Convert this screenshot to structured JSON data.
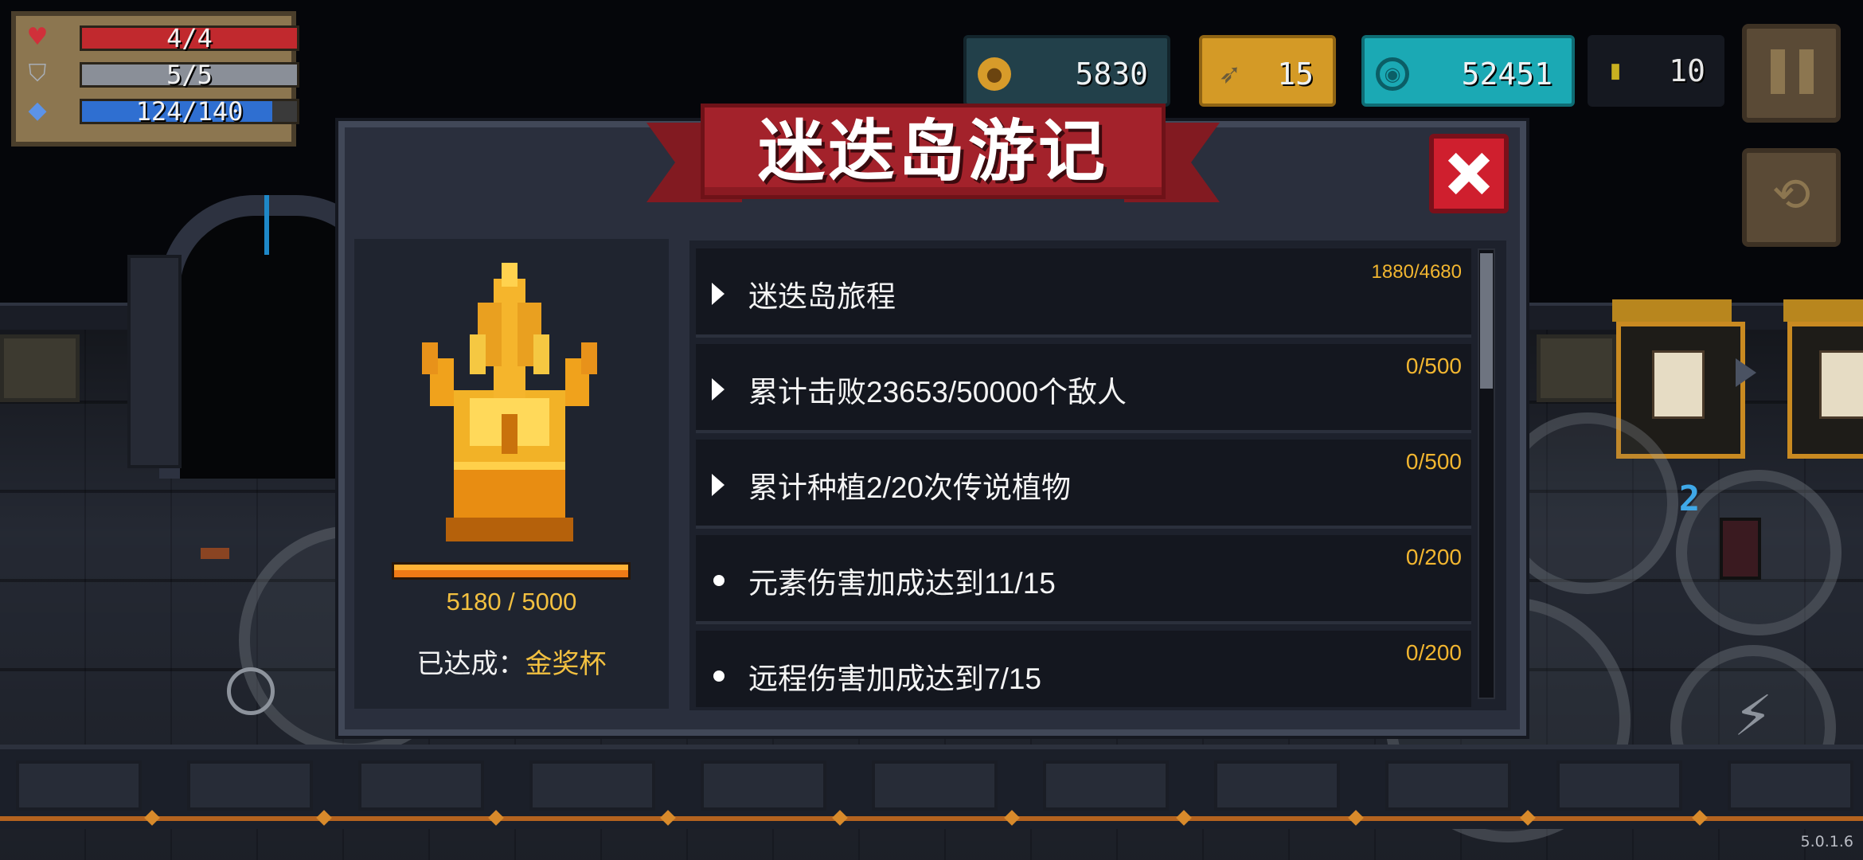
{
  "hud": {
    "health": {
      "label": "4/4",
      "current": 4,
      "max": 4,
      "color": "#c1292e",
      "icon": "heart-icon"
    },
    "armor": {
      "label": "5/5",
      "current": 5,
      "max": 5,
      "color": "#8a8f98",
      "icon": "shield-icon"
    },
    "energy": {
      "label": "124/140",
      "current": 124,
      "max": 140,
      "color": "#2f6fd1",
      "icon": "diamond-icon"
    }
  },
  "currencies": {
    "gold": {
      "value": "5830",
      "icon": "gold-coin-icon"
    },
    "fish": {
      "value": "15",
      "icon": "fish-icon"
    },
    "gems": {
      "value": "52451",
      "icon": "gem-icon"
    },
    "coins": {
      "value": "10",
      "icon": "small-coin-icon"
    }
  },
  "dialog": {
    "title": "迷迭岛游记",
    "trophy": {
      "progress_text": "5180 / 5000",
      "progress_fraction": 1.0,
      "achieved_label": "已达成：",
      "achieved_value": "金奖杯"
    },
    "tasks": [
      {
        "label": "迷迭岛旅程",
        "progress": "1880/4680",
        "marker": "triangle"
      },
      {
        "label": "累计击败23653/50000个敌人",
        "progress": "0/500",
        "marker": "triangle"
      },
      {
        "label": "累计种植2/20次传说植物",
        "progress": "0/500",
        "marker": "triangle"
      },
      {
        "label": "元素伤害加成达到11/15",
        "progress": "0/200",
        "marker": "dot"
      },
      {
        "label": "远程伤害加成达到7/15",
        "progress": "0/200",
        "marker": "dot"
      }
    ]
  },
  "side_badge": "2",
  "version": "5.0.1.6",
  "colors": {
    "accent_gold": "#f2c040",
    "banner_red": "#a3222b",
    "close_red": "#cf1f2e",
    "gem_teal": "#1ba9b4",
    "fish_orange": "#d49a26"
  }
}
